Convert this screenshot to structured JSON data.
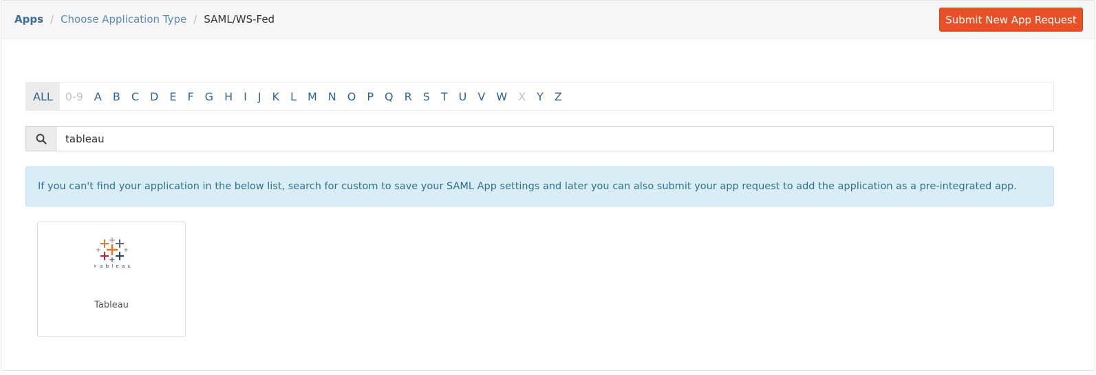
{
  "breadcrumb": {
    "root": "Apps",
    "link": "Choose Application Type",
    "active": "SAML/WS-Fed",
    "separator": "/"
  },
  "header": {
    "submit_label": "Submit New App Request"
  },
  "alphabet": {
    "items": [
      "ALL",
      "0-9",
      "A",
      "B",
      "C",
      "D",
      "E",
      "F",
      "G",
      "H",
      "I",
      "J",
      "K",
      "L",
      "M",
      "N",
      "O",
      "P",
      "Q",
      "R",
      "S",
      "T",
      "U",
      "V",
      "W",
      "X",
      "Y",
      "Z"
    ],
    "active": "ALL",
    "disabled": [
      "0-9",
      "X"
    ]
  },
  "search": {
    "value": "tableau",
    "icon": "search-icon"
  },
  "info": {
    "text": "If you can't find your application in the below list, search for custom to save your SAML App settings and later you can also submit your app request to add the application as a pre-integrated app."
  },
  "apps": [
    {
      "name": "Tableau",
      "logo_text": "+ a b l e a u",
      "icon": "tableau-logo"
    }
  ],
  "colors": {
    "accent": "#e85127",
    "link": "#2f6496",
    "info_bg": "#d9edf7",
    "info_text": "#31708f"
  }
}
